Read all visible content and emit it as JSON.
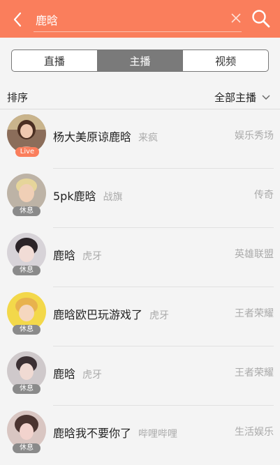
{
  "search": {
    "query": "鹿晗"
  },
  "tabs": [
    {
      "label": "直播",
      "active": false
    },
    {
      "label": "主播",
      "active": true
    },
    {
      "label": "视频",
      "active": false
    }
  ],
  "sort": {
    "label": "排序",
    "filter": "全部主播"
  },
  "results": [
    {
      "name": "杨大美原谅鹿晗",
      "platform": "来疯",
      "category": "娱乐秀场",
      "badge": "Live",
      "status": "live"
    },
    {
      "name": "5pk鹿晗",
      "platform": "战旗",
      "category": "传奇",
      "badge": "休息",
      "status": "rest"
    },
    {
      "name": "鹿晗",
      "platform": "虎牙",
      "category": "英雄联盟",
      "badge": "休息",
      "status": "rest"
    },
    {
      "name": "鹿晗欧巴玩游戏了",
      "platform": "虎牙",
      "category": "王者荣耀",
      "badge": "休息",
      "status": "rest"
    },
    {
      "name": "鹿晗",
      "platform": "虎牙",
      "category": "王者荣耀",
      "badge": "休息",
      "status": "rest"
    },
    {
      "name": "鹿晗我不要你了",
      "platform": "哔哩哔哩",
      "category": "生活娱乐",
      "badge": "休息",
      "status": "rest"
    }
  ],
  "colors": {
    "accent": "#fa7e5c",
    "rest_badge": "#8a8a8a"
  },
  "icons": {
    "back": "chevron-left-icon",
    "clear": "close-icon",
    "search": "search-icon",
    "filter": "chevron-down-icon"
  }
}
